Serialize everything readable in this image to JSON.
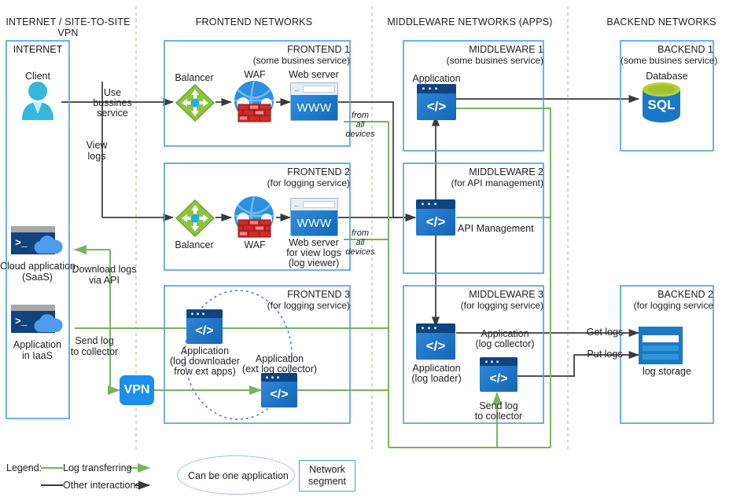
{
  "zones": [
    {
      "id": "internet",
      "title": "INTERNET / SITE-TO-SITE VPN"
    },
    {
      "id": "frontend",
      "title": "FRONTEND NETWORKS"
    },
    {
      "id": "middleware",
      "title": "MIDDLEWARE NETWORKS (APPS)"
    },
    {
      "id": "backend",
      "title": "BACKEND NETWORKS"
    }
  ],
  "segments": [
    {
      "id": "internet",
      "name": "INTERNET",
      "sub": ""
    },
    {
      "id": "frontend1",
      "name": "FRONTEND 1",
      "sub": "(some busines service)"
    },
    {
      "id": "frontend2",
      "name": "FRONTEND 2",
      "sub": "(for logging service)"
    },
    {
      "id": "frontend3",
      "name": "FRONTEND 3",
      "sub": "(for logging service)"
    },
    {
      "id": "middleware1",
      "name": "MIDDLEWARE 1",
      "sub": "(some busines service)"
    },
    {
      "id": "middleware2",
      "name": "MIDDLEWARE 2",
      "sub": "(for API management)"
    },
    {
      "id": "middleware3",
      "name": "MIDDLEWARE 3",
      "sub": "(for logging service)"
    },
    {
      "id": "backend1",
      "name": "BACKEND 1",
      "sub": "(some busines service)"
    },
    {
      "id": "backend2",
      "name": "BACKEND 2",
      "sub": "(for logging service"
    }
  ],
  "nodes": {
    "client": "Client",
    "cloud_saas_l1": "Cloud application",
    "cloud_saas_l2": "(SaaS)",
    "app_iaas_l1": "Application",
    "app_iaas_l2": "in IaaS",
    "vpn": "VPN",
    "balancer1": "Balancer",
    "waf1": "WAF",
    "webserver1": "Web server",
    "webserver1_www": "WWW",
    "balancer2": "Balancer",
    "waf2": "WAF",
    "webserver2_l1": "Web server",
    "webserver2_l2": "for view logs",
    "webserver2_l3": "(log viewer)",
    "webserver2_www": "WWW",
    "app_log_downloader_l1": "Application",
    "app_log_downloader_l2": "(log downloader",
    "app_log_downloader_l3": "frow ext apps)",
    "app_ext_collector_l1": "Application",
    "app_ext_collector_l2": "(ext log collector)",
    "mw1_app": "Application",
    "mw2_api": "API Management",
    "mw3_log_loader_l1": "Application",
    "mw3_log_loader_l2": "(log loader)",
    "mw3_log_collector_l1": "Application",
    "mw3_log_collector_l2": "(log collector)",
    "database": "Database",
    "database_sql": "SQL",
    "log_storage": "log storage",
    "appwin_code": "</>"
  },
  "edge_labels": {
    "use_business_service": "Use\nbussines\nservice",
    "use_business_l1": "Use",
    "use_business_l2": "bussines",
    "use_business_l3": "service",
    "view_logs_l1": "View",
    "view_logs_l2": "logs",
    "download_logs_l1": "Download logs",
    "download_logs_l2": "via API",
    "send_log_collector_l1": "Send log",
    "send_log_collector_l2": "to collector",
    "mw3_send_log_l1": "Send log",
    "mw3_send_log_l2": "to collector",
    "from_all_devices_1_l1": "from",
    "from_all_devices_1_l2": "all",
    "from_all_devices_1_l3": "devices",
    "from_all_devices_2_l1": "from",
    "from_all_devices_2_l2": "all",
    "from_all_devices_2_l3": "devices",
    "get_logs": "Get logs",
    "put_logs": "Put logs"
  },
  "legend": {
    "title": "Legend:",
    "log_transferring": "Log transferring",
    "other_interactions": "Other interactions",
    "can_be_one_application": "Can be one application",
    "network_segment_l1": "Network",
    "network_segment_l2": "segment"
  },
  "colors": {
    "log_green": "#79b35c",
    "interaction_black": "#3b3b3b",
    "segment_blue": "#4a9fe0",
    "zone_divider": "#d6cfa8",
    "app_blue": "#1f6fc4",
    "balancer_green": "#8cc63e",
    "waf_red": "#cf2a2a",
    "client_cyan": "#35b7dd",
    "vpn_blue": "#1b8ef0",
    "sql_blue": "#1b79c4",
    "sql_top_green": "#b4d333",
    "dotted_ellipse": "#3b7dd8"
  }
}
